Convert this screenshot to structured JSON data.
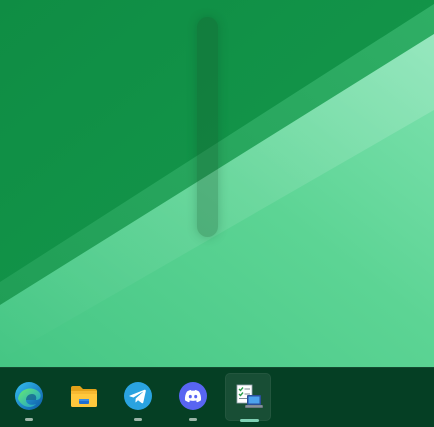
{
  "desktop": {
    "wallpaper_colors": {
      "dark": "#0f9146",
      "mid": "#2ead65",
      "light": "#5fd59a",
      "lighter": "#83e7b3"
    }
  },
  "taskbar": {
    "background": "#053f24",
    "apps": [
      {
        "name": "edge",
        "icon": "edge-icon",
        "running": true,
        "active": false
      },
      {
        "name": "file-explorer",
        "icon": "folder-icon",
        "running": false,
        "active": false
      },
      {
        "name": "telegram",
        "icon": "telegram-icon",
        "running": true,
        "active": false
      },
      {
        "name": "discord",
        "icon": "discord-icon",
        "running": true,
        "active": false
      },
      {
        "name": "remote-desktop-tools",
        "icon": "remote-desktop-icon",
        "running": true,
        "active": true
      }
    ]
  }
}
